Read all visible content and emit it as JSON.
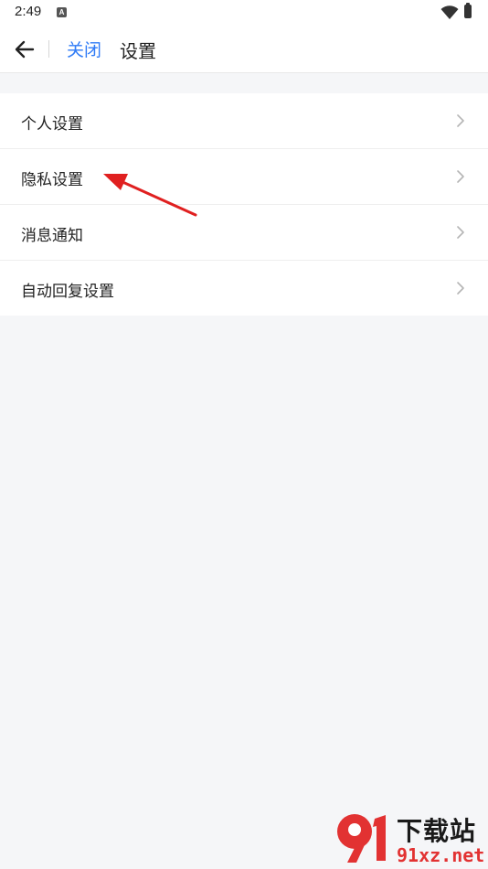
{
  "status_bar": {
    "time": "2:49",
    "notification_icon": "a-notification-icon",
    "wifi_icon": "wifi-icon",
    "battery_icon": "battery-icon"
  },
  "header": {
    "back_icon": "arrow-left-icon",
    "close_label": "关闭",
    "title": "设置"
  },
  "menu": {
    "items": [
      {
        "label": "个人设置",
        "icon": "chevron-right-icon"
      },
      {
        "label": "隐私设置",
        "icon": "chevron-right-icon"
      },
      {
        "label": "消息通知",
        "icon": "chevron-right-icon"
      },
      {
        "label": "自动回复设置",
        "icon": "chevron-right-icon"
      }
    ]
  },
  "annotation": {
    "color": "#e02020",
    "target": "隐私设置"
  },
  "watermark": {
    "logo_text": "91",
    "title": "下载站",
    "domain": "91xz.net"
  },
  "colors": {
    "accent": "#2f7bf6",
    "background": "#f5f6f8",
    "chevron": "#b5b5b5"
  }
}
